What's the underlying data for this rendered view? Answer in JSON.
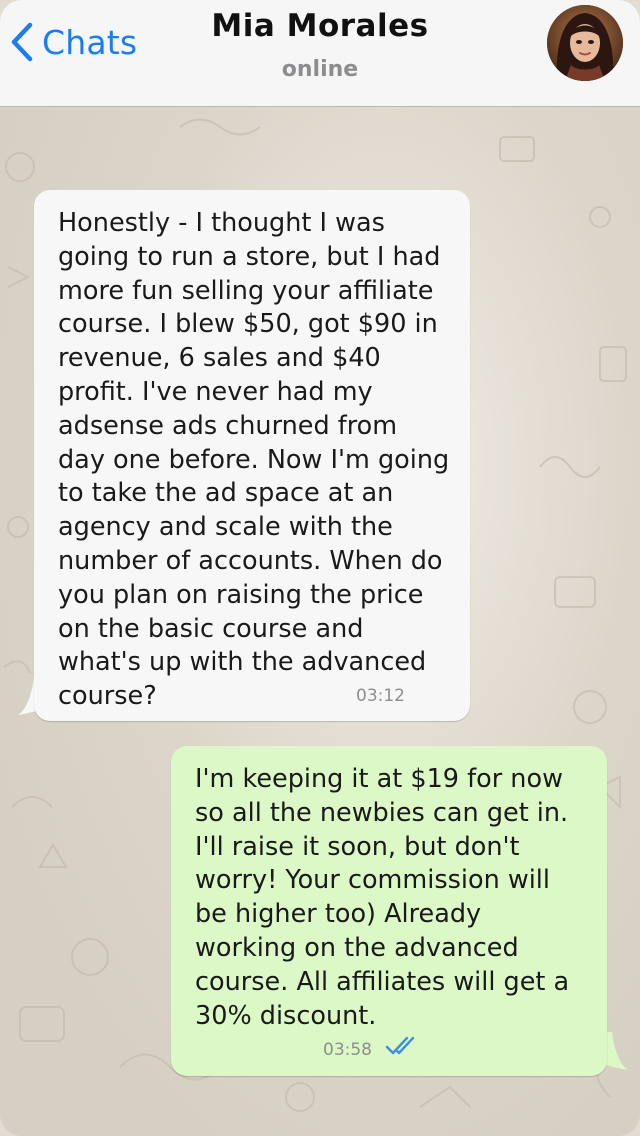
{
  "header": {
    "back_label": "Chats",
    "contact_name": "Mia Morales",
    "contact_status": "online"
  },
  "messages": [
    {
      "direction": "incoming",
      "text": "Honestly - I thought I was going to run a store, but I had more fun selling your affiliate course. I blew $50, got $90 in revenue, 6 sales and $40 profit. I've never had my adsense ads churned from day one before. Now I'm going to take the ad space at an agency and scale with the number of accounts. When do you plan on raising the price on the basic course and what's up with the advanced course?",
      "time": "03:12"
    },
    {
      "direction": "outgoing",
      "text": "I'm keeping it at $19 for now so all the newbies can get in. I'll raise it soon, but don't worry! Your commission will be higher too) Already working on the advanced course. All affiliates will get a 30% discount.",
      "time": "03:58",
      "status_icon": "double-check-read-icon"
    }
  ],
  "colors": {
    "accent": "#1e7cf2",
    "incoming_bubble": "#f7f7f7",
    "outgoing_bubble": "#dcf8c7",
    "read_ticks": "#3d8fe0"
  }
}
